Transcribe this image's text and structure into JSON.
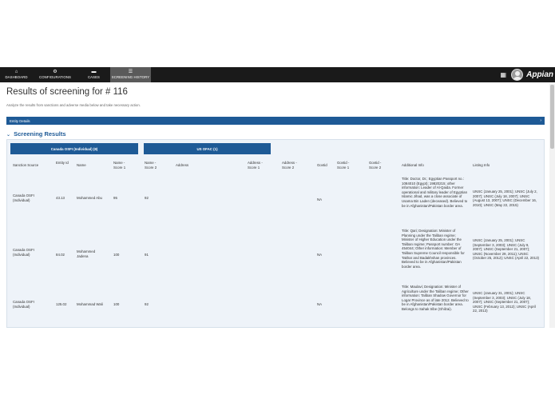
{
  "nav": {
    "items": [
      {
        "label": "DASHBOARD",
        "icon": "home-icon",
        "glyph": "⌂"
      },
      {
        "label": "CONFIGURATIONS",
        "icon": "cogs-icon",
        "glyph": "⚙"
      },
      {
        "label": "CASES",
        "icon": "folder-icon",
        "glyph": "▬"
      },
      {
        "label": "SCREENING HISTORY",
        "icon": "list-icon",
        "glyph": "☰"
      }
    ],
    "active": "SCREENING HISTORY",
    "grid_glyph": "▦",
    "logo": "Appian"
  },
  "page": {
    "title": "Results of screening for # 116",
    "subtitle": "Analyze the results from sanctions and adverse media below and take necessary action."
  },
  "entity_details": {
    "label": "Entity Details",
    "chevron": "›"
  },
  "screening_results": {
    "label": "Screening Results",
    "caret": "⌄",
    "groups": [
      "Canada OSFI (Individual) (8)",
      "US OFAC (1)"
    ],
    "columns": {
      "sanction_source": "Sanction Source",
      "entity_id": "Entity Id",
      "name": "Name",
      "name_score_1": "Name - Score 1",
      "name_score_2": "Name - Score 2",
      "address": "Address",
      "address_score_1": "Address - Score 1",
      "address_score_2": "Address - Score 2",
      "govtid": "Govtid",
      "govtid_score_1": "Govtid - Score 1",
      "govtid_score_2": "Govtid - Score 2",
      "additional_info": "Additional Info",
      "listing_info": "Listing Info"
    },
    "rows": [
      {
        "sanction_source": "Canada OSFI (Individual)",
        "entity_id": "43.13",
        "name": "Mohammed Abu",
        "name_score_1": "95",
        "name_score_2": "92",
        "govtid": "NA",
        "additional_info": "Title: Doctor, Dr.; Egyptian Passport no.: 1084010 (Egypt); 19820215; other information: Leader of Al-Qaida. Former operational and military leader of Egyptian Islamic Jihad, was a close associate of Usama Bin Laden (deceased). Believed to be in Afghanistan/Pakistan border area.",
        "listing_info": "UNSC (January 25, 2001); UNSC (July 2, 2007); UNSC (July 18, 2007); UNSC (August 13, 2007); UNSC (December 16, 2010); UNSC (May 22, 2015)"
      },
      {
        "sanction_source": "Canada OSFI (Individual)",
        "entity_id": "84.02",
        "name": "Mohammed Jadena",
        "name_score_1": "100",
        "name_score_2": "91",
        "govtid": "NA",
        "additional_info": "Title: Qari; Designation: Minister of Planning under the Taliban regime; Minister of Higher Education under the Taliban regime; Passport number: OA 454044; Other information: Member of Taliban Supreme Council responsible for Takhar and Badakhshan provinces. Believed to be in Afghanistan/Pakistan border area.",
        "listing_info": "UNSC (January 25, 2001); UNSC (September 3, 2003); UNSC (July 9, 2007); UNSC (September 21, 2007); UNSC (November 29, 2011); UNSC (October 25, 2012); UNSC (April 22, 2013)"
      },
      {
        "sanction_source": "Canada OSFI (Individual)",
        "entity_id": "125.02",
        "name": "Mohammad Wali",
        "name_score_1": "100",
        "name_score_2": "92",
        "govtid": "NA",
        "additional_info": "Title: Maulavi; Designation: Minister of Agriculture under the Taliban regime; Other information: Taliban Shadow Governor for Logar Province as of late 2012. Believed to be in Afghanistan/Pakistan border area. Belongs to Sahak tribe (Ghilzai).",
        "listing_info": "UNSC (January 31, 2001); UNSC (September 3, 2003); UNSC (July 18, 2007); UNSC (September 21, 2007); UNSC (February 13, 2012); UNSC (April 22, 2013)"
      }
    ]
  },
  "colors": {
    "primary": "#1e5a96",
    "topbar": "#1a1a1a",
    "active_tab": "#5a5a5a",
    "panel": "#eef3f9"
  }
}
